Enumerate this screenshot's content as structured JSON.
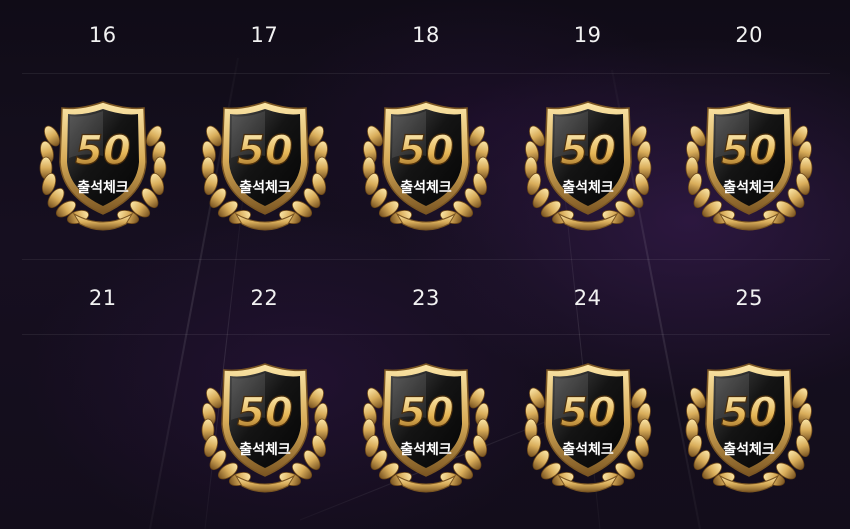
{
  "calendar": {
    "weeks": [
      {
        "days": [
          {
            "day": "16",
            "reward": {
              "amount": "50",
              "label": "출석체크"
            }
          },
          {
            "day": "17",
            "reward": {
              "amount": "50",
              "label": "출석체크"
            }
          },
          {
            "day": "18",
            "reward": {
              "amount": "50",
              "label": "출석체크"
            }
          },
          {
            "day": "19",
            "reward": {
              "amount": "50",
              "label": "출석체크"
            }
          },
          {
            "day": "20",
            "reward": {
              "amount": "50",
              "label": "출석체크"
            }
          }
        ]
      },
      {
        "days": [
          {
            "day": "21",
            "reward": null
          },
          {
            "day": "22",
            "reward": {
              "amount": "50",
              "label": "출석체크"
            }
          },
          {
            "day": "23",
            "reward": {
              "amount": "50",
              "label": "출석체크"
            }
          },
          {
            "day": "24",
            "reward": {
              "amount": "50",
              "label": "출석체크"
            }
          },
          {
            "day": "25",
            "reward": {
              "amount": "50",
              "label": "출석체크"
            }
          }
        ]
      }
    ]
  },
  "colors": {
    "background": "#120d1a",
    "grid_line": "#2a2433",
    "day_text": "#f2f2f2",
    "gold_light": "#fbe6a8",
    "gold": "#d9ad5a",
    "gold_dark": "#7a5522",
    "shield_dark": "#141414"
  }
}
